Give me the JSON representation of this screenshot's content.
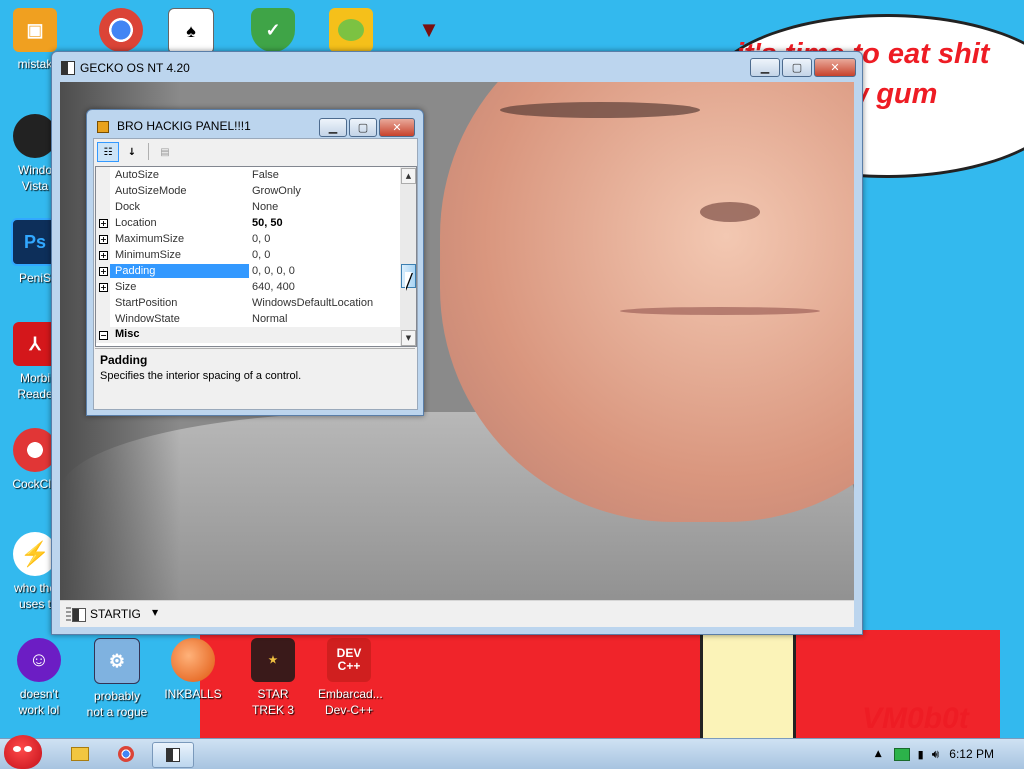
{
  "desktop": {
    "bubble_text": "it's time to eat shit and chew gum",
    "signature": "VM0b0t",
    "icons": [
      {
        "label": "mistak"
      },
      {
        "label": ""
      },
      {
        "label": ""
      },
      {
        "label": ""
      },
      {
        "label": ""
      },
      {
        "label": ""
      },
      {
        "label": "Windo Vista"
      },
      {
        "label": "PeniS"
      },
      {
        "label": "Morbi Reade"
      },
      {
        "label": "CockCle"
      },
      {
        "label": "who the uses t"
      },
      {
        "label": "doesn't work lol"
      },
      {
        "label": "probably not a rogue"
      },
      {
        "label": "INKBALLS"
      },
      {
        "label": "STAR TREK 3"
      },
      {
        "label": "Embarcad... Dev-C++"
      }
    ],
    "icon_glyphs": {
      "photoshop": "Ps",
      "devcpp": "DEV C++"
    }
  },
  "main_window": {
    "title": "GECKO OS NT 4.20",
    "status_start": "STARTIG"
  },
  "property_panel": {
    "title": "BRO HACKIG PANEL!!!1",
    "rows": [
      {
        "name": "AutoSize",
        "value": "False",
        "expander": ""
      },
      {
        "name": "AutoSizeMode",
        "value": "GrowOnly",
        "expander": ""
      },
      {
        "name": "Dock",
        "value": "None",
        "expander": ""
      },
      {
        "name": "Location",
        "value": "50, 50",
        "expander": "+"
      },
      {
        "name": "MaximumSize",
        "value": "0, 0",
        "expander": "+"
      },
      {
        "name": "MinimumSize",
        "value": "0, 0",
        "expander": "+"
      },
      {
        "name": "Padding",
        "value": "0, 0, 0, 0",
        "expander": "+"
      },
      {
        "name": "Size",
        "value": "640, 400",
        "expander": "+"
      },
      {
        "name": "StartPosition",
        "value": "WindowsDefaultLocation",
        "expander": ""
      },
      {
        "name": "WindowState",
        "value": "Normal",
        "expander": ""
      }
    ],
    "category": {
      "name": "Misc",
      "expander": "−"
    },
    "description": {
      "title": "Padding",
      "text": "Specifies the interior spacing of a control."
    }
  },
  "taskbar": {
    "clock": "6:12 PM"
  },
  "colors": {
    "desktop": "#33b9ee",
    "accent_red": "#ee1c24",
    "selection": "#3399ff"
  }
}
